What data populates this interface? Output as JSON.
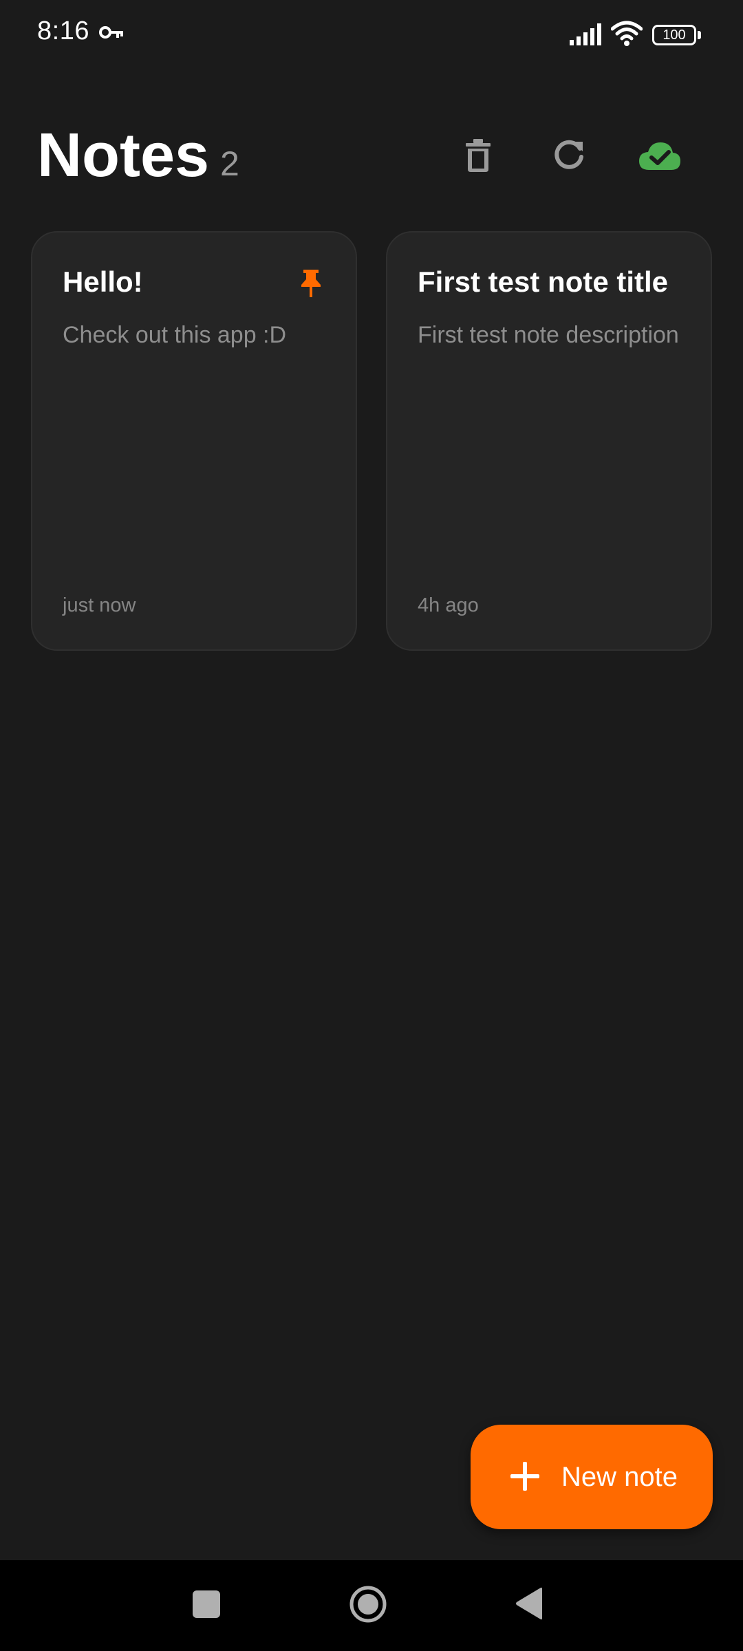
{
  "status_bar": {
    "time": "8:16",
    "battery": "100",
    "icons": [
      "vpn-key-icon",
      "cellular-signal-icon",
      "wifi-icon",
      "battery-icon"
    ]
  },
  "header": {
    "title": "Notes",
    "count": "2",
    "actions": [
      "delete-icon",
      "refresh-icon",
      "cloud-sync-done-icon"
    ]
  },
  "notes": [
    {
      "title": "Hello!",
      "description": "Check out this app :D",
      "time": "just now",
      "pinned": true
    },
    {
      "title": "First test note title",
      "description": "First test note description",
      "time": "4h ago",
      "pinned": false
    }
  ],
  "fab": {
    "label": "New note",
    "icon": "plus-icon"
  },
  "navigation": [
    "recents-icon",
    "home-icon",
    "back-icon"
  ],
  "colors": {
    "background": "#1b1b1b",
    "card": "#252525",
    "accent": "#ff6a00",
    "sync_ok": "#4caf50",
    "icon_gray": "#9a9a9a"
  }
}
